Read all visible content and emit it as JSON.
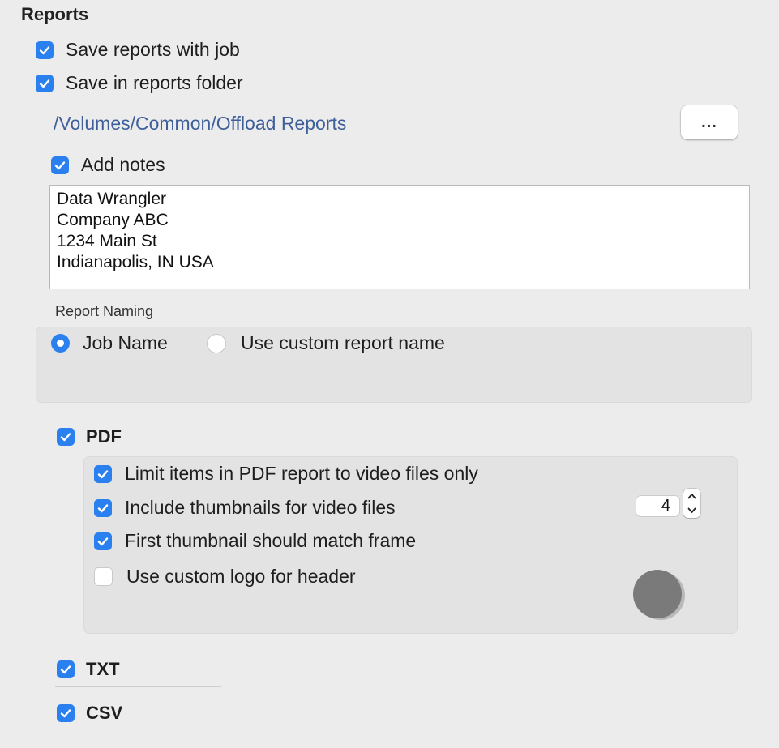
{
  "title": "Reports",
  "options": {
    "save_with_job": {
      "label": "Save reports with job",
      "checked": true
    },
    "save_in_folder": {
      "label": "Save in reports folder",
      "checked": true
    },
    "folder_path": "/Volumes/Common/Offload Reports",
    "browse_label": "...",
    "add_notes": {
      "label": "Add notes",
      "checked": true
    }
  },
  "notes_lines": [
    "Data Wrangler",
    "Company ABC",
    "1234 Main St",
    "Indianapolis, IN USA"
  ],
  "report_naming": {
    "label": "Report Naming",
    "job_name": {
      "label": "Job Name",
      "selected": true
    },
    "custom_name": {
      "label": "Use custom report name",
      "selected": false
    }
  },
  "pdf": {
    "label": "PDF",
    "checked": true,
    "limit_video": {
      "label": "Limit items in PDF report to video files only",
      "checked": true
    },
    "thumbnails": {
      "label": "Include thumbnails for video files",
      "checked": true,
      "count": "4"
    },
    "first_thumb": {
      "label": "First thumbnail should match frame",
      "checked": true
    },
    "custom_logo": {
      "label": "Use custom logo for header",
      "checked": false
    }
  },
  "txt": {
    "label": "TXT",
    "checked": true
  },
  "csv": {
    "label": "CSV",
    "checked": true
  },
  "colors": {
    "accent": "#2b80f0",
    "path_link": "#3f5f9a",
    "background": "#ececec"
  }
}
